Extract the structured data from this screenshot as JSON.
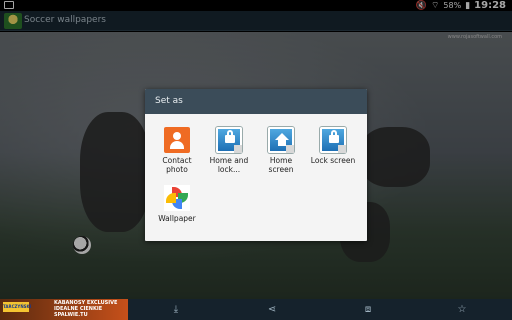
{
  "status_bar": {
    "battery": "58%",
    "time": "19:28"
  },
  "app_bar": {
    "title": "Soccer wallpapers"
  },
  "wallpaper": {
    "watermark": "www.rojasoftwall.com"
  },
  "dialog": {
    "title": "Set as",
    "options": [
      {
        "label": "Contact\nphoto",
        "icon": "contact-photo-icon"
      },
      {
        "label": "Home and\nlock...",
        "icon": "home-and-lock-icon"
      },
      {
        "label": "Home\nscreen",
        "icon": "home-screen-icon"
      },
      {
        "label": "Lock screen",
        "icon": "lock-screen-icon"
      },
      {
        "label": "Wallpaper",
        "icon": "wallpaper-photos-icon"
      }
    ]
  },
  "bottom_bar": {
    "ad": {
      "brand": "TARCZYŃSKI",
      "text": "KABANOSY EXCLUSIVE\nIDEALNE CIENKIE\nSPALWIE.TU"
    },
    "icons": [
      "download-icon",
      "share-icon",
      "crop-icon",
      "star-icon"
    ]
  }
}
